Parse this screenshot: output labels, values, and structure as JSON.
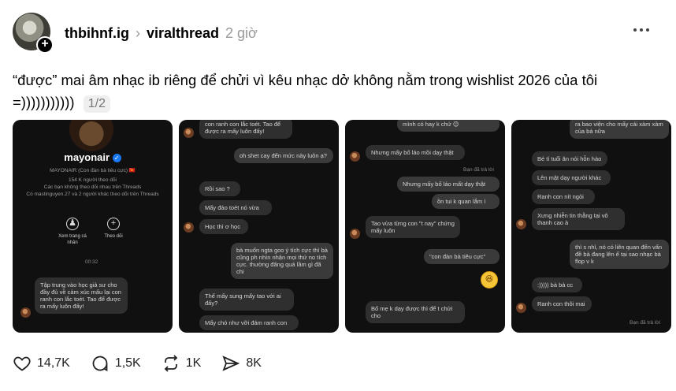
{
  "post": {
    "author": "thbihnf.ig",
    "thread": "viralthread",
    "time": "2 giờ",
    "caption": "“được” mai âm nhạc ib riêng để chửi vì kêu nhạc dở không nằm trong wishlist 2026 của tôi =)))))))))))",
    "page_indicator": "1/2"
  },
  "icons": {
    "more": "more-horizontal-icon",
    "follow": "plus-icon",
    "separator": "chevron-right-icon"
  },
  "images": {
    "card1": {
      "profile_name": "mayonair",
      "profile_sub": "MAYONAIR (Con đàn bà tiêu cực) 🇻🇳",
      "followers": "154 K người theo dõi",
      "not_following": "Các bạn không theo dõi nhau trên Threads",
      "mutual": "Có mastinguyen.27 và 2 người khác theo dõi trên Threads",
      "btn_profile": "Xem trang cá nhân",
      "btn_follow": "Theo dõi",
      "time": "00:32",
      "msg1": "Tập trung vào học giả sư cho đầy đủ về cảm xúc mấu lại con ranh con lắc toét. Tao để được ra mấy luôn đấy!"
    },
    "card2": {
      "m1": "con ranh con lắc toét. Tao để được ra mấy luôn đấy!",
      "m2": "oh shet cay đến mức này luôn ạ?",
      "m3": "Rồi sao ?",
      "m4": "Mấy đáo toét nó vừa",
      "m5": "Học thì ơ học",
      "m6": "bà muốn ngta goo ý tích cực thì bà cũng ph nhìn nhận mọi thứ no tích cực. thường đăng quá lầm gì đã chi",
      "m7": "Thế mấy sung mấy tao với ai đấy?",
      "m8": "Mấy chó như vỡi đám ranh con"
    },
    "card3": {
      "m1": "mình có hay k chứ 😊",
      "m2": "Nhưng mấy bố láo mồi dạy thật",
      "t1": "Bạn đã trả lời",
      "m3": "Nhưng mấy bố láo mất dạy thật",
      "m4": "ồn tui k quan lắm í",
      "m5": "Tao vừa từng con \"t nay\" chứng mấy luôn",
      "m6": "\"con đàn bà tiêu cực\"",
      "m7": "Bố mẹ k dạy được thì để t chửi cho"
    },
    "card4": {
      "m1": "ra bao viện cho mấy cái xàm xàm của bà nữa",
      "m2": "Bé tí tuổi ăn nói hỗn hào",
      "m3": "Lên mặt dạy người khác",
      "m4": "Ranh con nít ngỏi",
      "m5": "Xưng nhiễn tin thằng tại vô thanh cao à",
      "m6": "thì s nhỉ, nó có liên quan đến vấn đề bà đang lên ế tại sao nhạc bà flop v k",
      "m7": ":))))) bà bả cc",
      "m8": "Ranh con thôi mai",
      "t1": "Bạn đã trả lời"
    }
  },
  "actions": {
    "likes": "14,7K",
    "comments": "1,5K",
    "reposts": "1K",
    "shares": "8K"
  }
}
